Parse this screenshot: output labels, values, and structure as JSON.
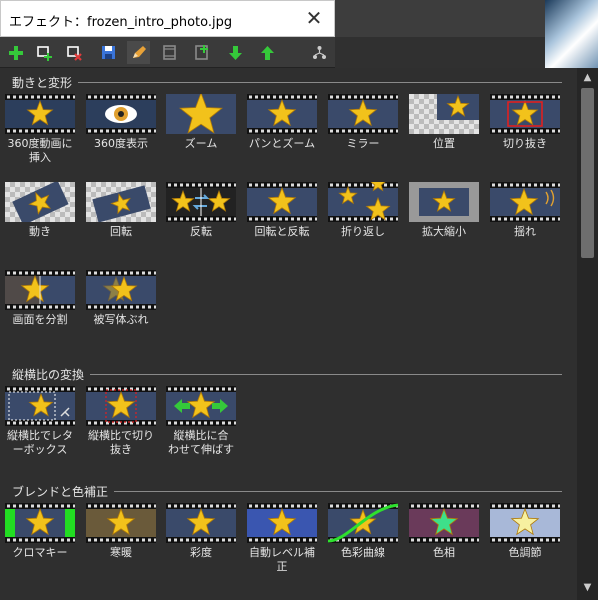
{
  "window": {
    "title": "エフェクト：frozen_intro_photo.jpg",
    "close_glyph": "✕"
  },
  "toolbar": [
    {
      "name": "add-icon",
      "color": "#35c93a"
    },
    {
      "name": "add-duplicate-icon",
      "color": "#ffffff"
    },
    {
      "name": "remove-icon",
      "color": "#e03a3a"
    },
    {
      "name": "save-icon",
      "color": "#3a74d8"
    },
    {
      "name": "edit-pencil-icon",
      "color": "#e8a238"
    },
    {
      "name": "film-frame-icon",
      "color": "#8a8a8a"
    },
    {
      "name": "film-add-icon",
      "color": "#8a8a8a"
    },
    {
      "name": "move-down-icon",
      "color": "#35c93a"
    },
    {
      "name": "move-up-icon",
      "color": "#35c93a"
    },
    {
      "name": "tree-icon",
      "color": "#cccccc"
    }
  ],
  "sections": [
    {
      "title": "動きと変形",
      "items": [
        {
          "label": "360度動画に挿入",
          "l1": "360度動画に",
          "l2": "挿入",
          "bg": "#2c3e5c",
          "kind": "pano"
        },
        {
          "label": "360度表示",
          "l1": "360度表示",
          "l2": "",
          "bg": "#2c3e5c",
          "kind": "eye"
        },
        {
          "label": "ズーム",
          "l1": "ズーム",
          "l2": "",
          "bg": "#3a4a6a",
          "kind": "zoom"
        },
        {
          "label": "パンとズーム",
          "l1": "パンとズーム",
          "l2": "",
          "bg": "#3a4a6a",
          "kind": "film"
        },
        {
          "label": "ミラー",
          "l1": "ミラー",
          "l2": "",
          "bg": "#3a4a6a",
          "kind": "film"
        },
        {
          "label": "位置",
          "l1": "位置",
          "l2": "",
          "bg": "#888888",
          "kind": "position"
        },
        {
          "label": "切り抜き",
          "l1": "切り抜き",
          "l2": "",
          "bg": "#3a4a6a",
          "kind": "crop"
        },
        {
          "label": "動き",
          "l1": "動き",
          "l2": "",
          "bg": "#888888",
          "kind": "move"
        },
        {
          "label": "回転",
          "l1": "回転",
          "l2": "",
          "bg": "#888888",
          "kind": "rotate"
        },
        {
          "label": "反転",
          "l1": "反転",
          "l2": "",
          "bg": "#222222",
          "kind": "flip"
        },
        {
          "label": "回転と反転",
          "l1": "回転と反転",
          "l2": "",
          "bg": "#3a4a6a",
          "kind": "film"
        },
        {
          "label": "折り返し",
          "l1": "折り返し",
          "l2": "",
          "bg": "#3a4a6a",
          "kind": "wrap"
        },
        {
          "label": "拡大縮小",
          "l1": "拡大縮小",
          "l2": "",
          "bg": "#999999",
          "kind": "scale"
        },
        {
          "label": "揺れ",
          "l1": "揺れ",
          "l2": "",
          "bg": "#3a4a6a",
          "kind": "shake"
        },
        {
          "label": "画面を分割",
          "l1": "画面を分割",
          "l2": "",
          "bg": "#3a4a6a",
          "kind": "split"
        },
        {
          "label": "被写体ぶれ",
          "l1": "被写体ぶれ",
          "l2": "",
          "bg": "#3a4a6a",
          "kind": "blur"
        }
      ]
    },
    {
      "title": "縦横比の変換",
      "items": [
        {
          "label": "縦横比でレターボックス",
          "l1": "縦横比でレタ",
          "l2": "ーボックス",
          "bg": "#3a4a6a",
          "kind": "letterbox"
        },
        {
          "label": "縦横比で切り抜き",
          "l1": "縦横比で切り",
          "l2": "抜き",
          "bg": "#3a4a6a",
          "kind": "aspectcrop"
        },
        {
          "label": "縦横比に合わせて伸ばす",
          "l1": "縦横比に合",
          "l2": "わせて伸ばす",
          "bg": "#3a4a6a",
          "kind": "stretch"
        }
      ]
    },
    {
      "title": "ブレンドと色補正",
      "items": [
        {
          "label": "クロマキー",
          "l1": "クロマキー",
          "l2": "",
          "bg": "#22dd22",
          "kind": "chroma"
        },
        {
          "label": "寒暖",
          "l1": "寒暖",
          "l2": "",
          "bg": "#6a5a3a",
          "kind": "film"
        },
        {
          "label": "彩度",
          "l1": "彩度",
          "l2": "",
          "bg": "#3a4a6a",
          "kind": "film"
        },
        {
          "label": "自動レベル補正",
          "l1": "自動レベル補",
          "l2": "正",
          "bg": "#3a56b0",
          "kind": "film"
        },
        {
          "label": "色彩曲線",
          "l1": "色彩曲線",
          "l2": "",
          "bg": "#3a4a6a",
          "kind": "curve"
        },
        {
          "label": "色相",
          "l1": "色相",
          "l2": "",
          "bg": "#6a3a5a",
          "kind": "hue"
        },
        {
          "label": "色調節",
          "l1": "色調節",
          "l2": "",
          "bg": "#a8b8d8",
          "kind": "tone"
        }
      ]
    }
  ],
  "colors": {
    "star": "#f2c21b",
    "star_edge": "#b07a08",
    "hue_star": "#3ee08a",
    "tone_star": "#f7f0a0"
  }
}
